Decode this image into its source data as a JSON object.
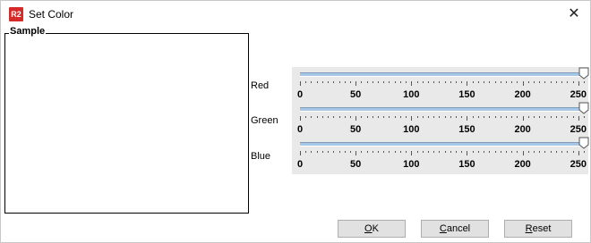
{
  "window": {
    "icon_text": "R2",
    "title": "Set Color",
    "close_glyph": "✕"
  },
  "sample": {
    "legend": "Sample",
    "color": "#ffffff"
  },
  "channels": [
    {
      "label": "Red",
      "value": 255
    },
    {
      "label": "Green",
      "value": 255
    },
    {
      "label": "Blue",
      "value": 255
    }
  ],
  "scale": {
    "min": 0,
    "max": 255,
    "labels": [
      "0",
      "50",
      "100",
      "150",
      "200",
      "250"
    ]
  },
  "buttons": {
    "ok": {
      "mnemonic": "O",
      "rest": "K"
    },
    "cancel": {
      "mnemonic": "C",
      "rest": "ancel"
    },
    "reset": {
      "mnemonic": "R",
      "rest": "eset"
    }
  },
  "colors": {
    "track": "#a7c7e6",
    "panel": "#e9e9e9",
    "icon_bg": "#d42a2a"
  }
}
